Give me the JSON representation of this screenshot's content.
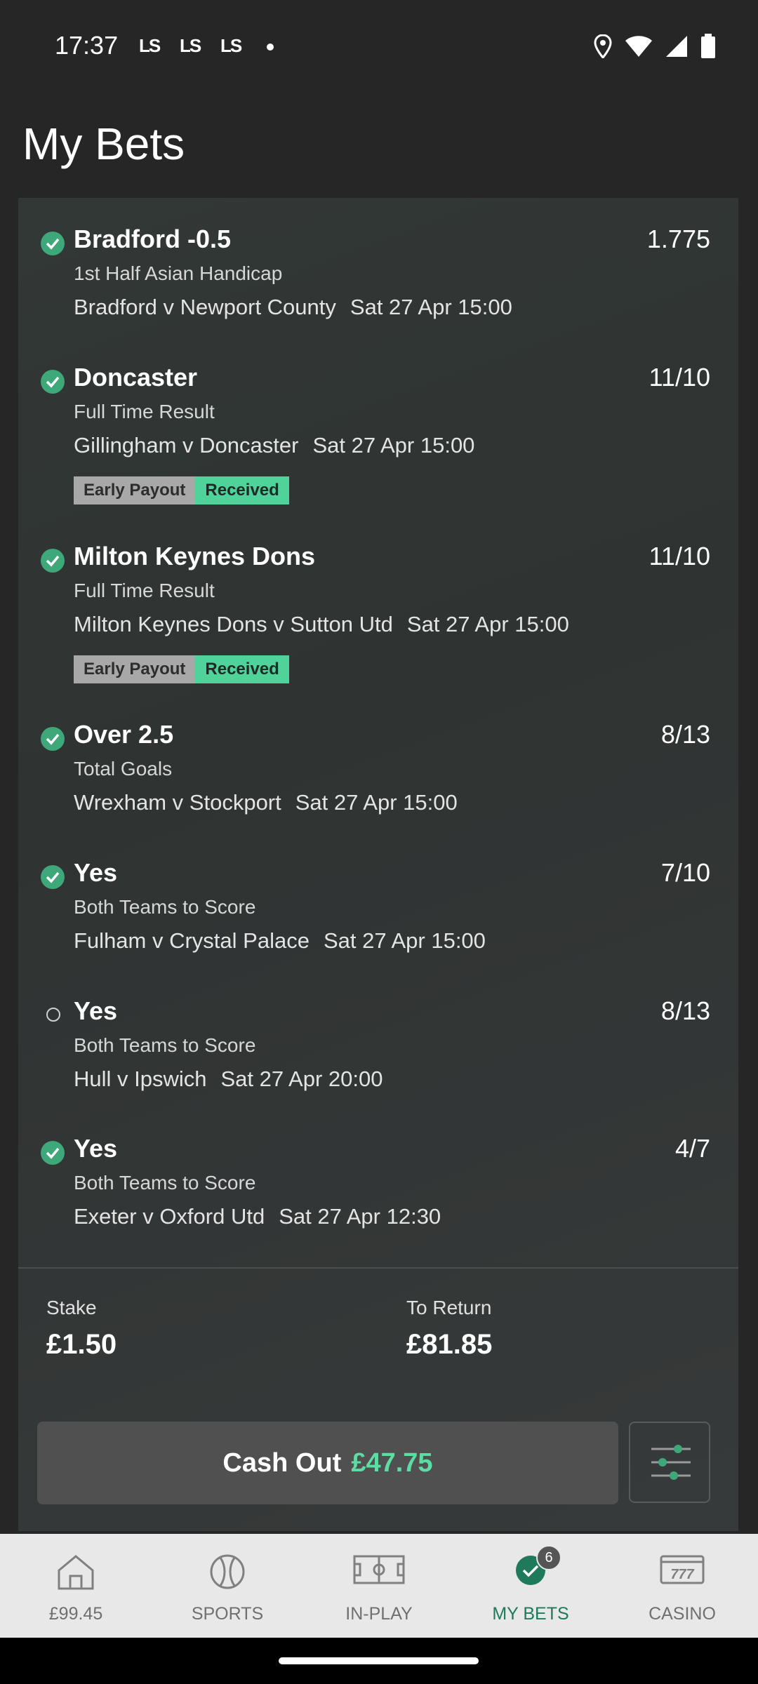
{
  "status": {
    "time": "17:37",
    "apps": [
      "LS",
      "LS",
      "LS"
    ]
  },
  "page": {
    "title": "My Bets"
  },
  "bets": [
    {
      "selection": "Bradford -0.5",
      "odds": "1.775",
      "market": "1st Half Asian Handicap",
      "event": "Bradford v Newport County",
      "time": "Sat 27 Apr 15:00",
      "status": "won"
    },
    {
      "selection": "Doncaster",
      "odds": "11/10",
      "market": "Full Time Result",
      "event": "Gillingham v Doncaster",
      "time": "Sat 27 Apr 15:00",
      "status": "won",
      "badge": {
        "label": "Early Payout",
        "status": "Received"
      }
    },
    {
      "selection": "Milton Keynes Dons",
      "odds": "11/10",
      "market": "Full Time Result",
      "event": "Milton Keynes Dons v Sutton Utd",
      "time": "Sat 27 Apr 15:00",
      "status": "won",
      "badge": {
        "label": "Early Payout",
        "status": "Received"
      }
    },
    {
      "selection": "Over 2.5",
      "odds": "8/13",
      "market": "Total Goals",
      "event": "Wrexham v Stockport",
      "time": "Sat 27 Apr 15:00",
      "status": "won"
    },
    {
      "selection": "Yes",
      "odds": "7/10",
      "market": "Both Teams to Score",
      "event": "Fulham v Crystal Palace",
      "time": "Sat 27 Apr 15:00",
      "status": "won"
    },
    {
      "selection": "Yes",
      "odds": "8/13",
      "market": "Both Teams to Score",
      "event": "Hull v Ipswich",
      "time": "Sat 27 Apr 20:00",
      "status": "pending"
    },
    {
      "selection": "Yes",
      "odds": "4/7",
      "market": "Both Teams to Score",
      "event": "Exeter v Oxford Utd",
      "time": "Sat 27 Apr 12:30",
      "status": "won"
    }
  ],
  "summary": {
    "stake_label": "Stake",
    "stake_value": "£1.50",
    "return_label": "To Return",
    "return_value": "£81.85"
  },
  "cashout": {
    "label": "Cash Out",
    "amount": "£47.75"
  },
  "nav": [
    {
      "label": "£99.45",
      "icon": "home-icon"
    },
    {
      "label": "SPORTS",
      "icon": "ball-icon"
    },
    {
      "label": "IN-PLAY",
      "icon": "pitch-icon"
    },
    {
      "label": "MY BETS",
      "icon": "check-icon",
      "badge": "6",
      "active": true
    },
    {
      "label": "CASINO",
      "icon": "slot-machine-icon"
    }
  ],
  "colors": {
    "accent": "#3ea87a",
    "cashout_amount": "#5fdca3",
    "received_badge": "#4fd39a",
    "active_nav": "#1e7a5a"
  }
}
